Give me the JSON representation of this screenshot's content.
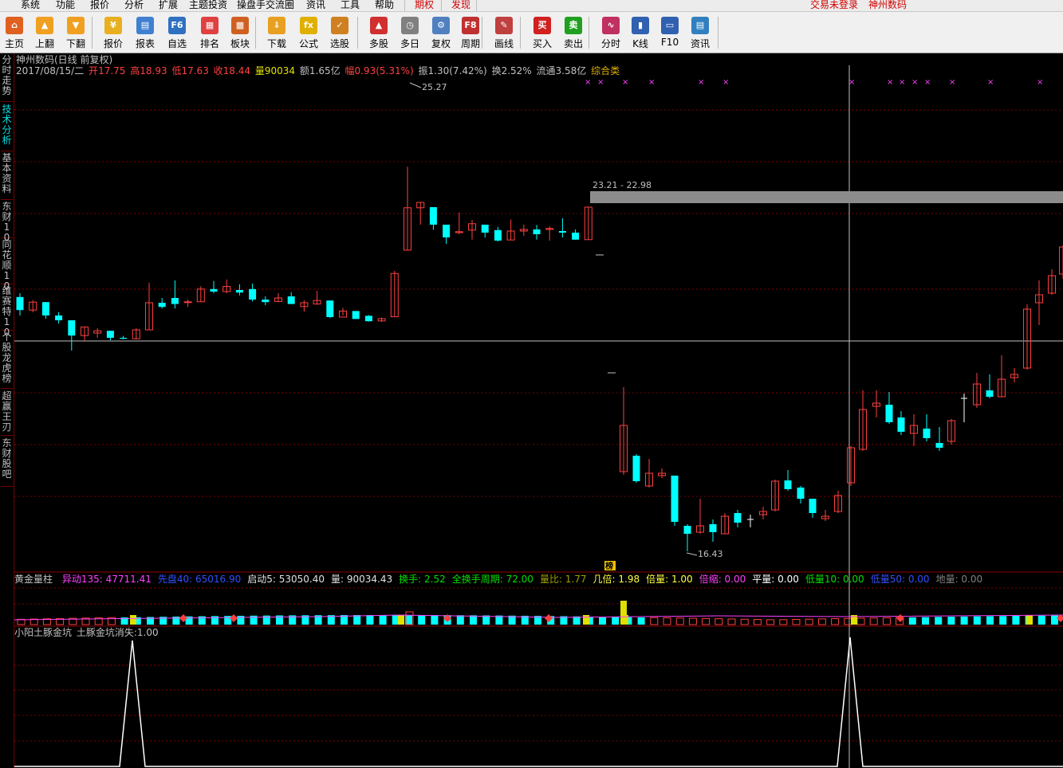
{
  "menu": {
    "items": [
      "系统",
      "功能",
      "报价",
      "分析",
      "扩展",
      "主题投资",
      "操盘手交流圈",
      "资讯",
      "工具",
      "帮助"
    ],
    "special": [
      "期权",
      "发现"
    ],
    "login_status": "交易未登录",
    "account_name": "神州数码"
  },
  "toolbar": {
    "buttons": [
      {
        "label": "主页",
        "icon": "home-icon",
        "color": "#e06020",
        "glyph": "⌂"
      },
      {
        "label": "上翻",
        "icon": "arrow-up-icon",
        "color": "#f0a020",
        "glyph": "▲"
      },
      {
        "label": "下翻",
        "icon": "arrow-down-icon",
        "color": "#f0a020",
        "glyph": "▼"
      },
      {
        "label": "报价",
        "icon": "yen-icon",
        "color": "#e8b020",
        "glyph": "¥"
      },
      {
        "label": "报表",
        "icon": "report-icon",
        "color": "#4080d0",
        "glyph": "▤"
      },
      {
        "label": "自选",
        "icon": "f6-icon",
        "color": "#3070c0",
        "glyph": "F6"
      },
      {
        "label": "排名",
        "icon": "rank-icon",
        "color": "#e04040",
        "glyph": "▦"
      },
      {
        "label": "板块",
        "icon": "sector-icon",
        "color": "#d06020",
        "glyph": "▩"
      },
      {
        "label": "下载",
        "icon": "download-icon",
        "color": "#e8a020",
        "glyph": "⇓"
      },
      {
        "label": "公式",
        "icon": "formula-icon",
        "color": "#e0b000",
        "glyph": "fx"
      },
      {
        "label": "选股",
        "icon": "stock-pick-icon",
        "color": "#d08020",
        "glyph": "✓"
      },
      {
        "label": "多股",
        "icon": "multi-stock-icon",
        "color": "#d03030",
        "glyph": "▲"
      },
      {
        "label": "多日",
        "icon": "multi-day-icon",
        "color": "#808080",
        "glyph": "◷"
      },
      {
        "label": "复权",
        "icon": "restore-right-icon",
        "color": "#5080c0",
        "glyph": "⚙"
      },
      {
        "label": "周期",
        "icon": "period-f8-icon",
        "color": "#c03030",
        "glyph": "F8"
      },
      {
        "label": "画线",
        "icon": "draw-line-icon",
        "color": "#c04040",
        "glyph": "✎"
      },
      {
        "label": "买入",
        "icon": "buy-icon",
        "color": "#d02020",
        "glyph": "买"
      },
      {
        "label": "卖出",
        "icon": "sell-icon",
        "color": "#20a020",
        "glyph": "卖"
      },
      {
        "label": "分时",
        "icon": "intraday-icon",
        "color": "#c03060",
        "glyph": "∿"
      },
      {
        "label": "K线",
        "icon": "kline-icon",
        "color": "#3060b0",
        "glyph": "▮"
      },
      {
        "label": "F10",
        "icon": "f10-icon",
        "color": "#3060b0",
        "glyph": "▭"
      },
      {
        "label": "资讯",
        "icon": "news-icon",
        "color": "#3080c0",
        "glyph": "▤"
      }
    ]
  },
  "sidebar": {
    "tabs": [
      {
        "label": "分时走势",
        "active": false
      },
      {
        "label": "技术分析",
        "active": true
      },
      {
        "label": "基本资料",
        "active": false
      },
      {
        "label": "东财10",
        "active": false
      },
      {
        "label": "同花顺10",
        "active": false
      },
      {
        "label": "维赛特10",
        "active": false
      },
      {
        "label": "个股龙虎榜",
        "active": false
      },
      {
        "label": "超赢王刃",
        "active": false
      },
      {
        "label": "东财股吧",
        "active": false
      }
    ]
  },
  "stock": {
    "title": "神州数码(日线 前复权)",
    "date": "2017/08/15/二",
    "open_label": "开",
    "open": "17.75",
    "high_label": "高",
    "high": "18.93",
    "low_label": "低",
    "low": "17.63",
    "close_label": "收",
    "close": "18.44",
    "volume_label": "量",
    "volume": "90034",
    "amount_label": "额",
    "amount": "1.65亿",
    "change_label": "幅",
    "change": "0.93(5.31%)",
    "amplitude_label": "振",
    "amplitude": "1.30(7.42%)",
    "turnover_label": "换",
    "turnover": "2.52%",
    "float_label": "流通",
    "float": "3.58亿",
    "category": "综合类"
  },
  "chart_labels": {
    "peak": "25.27",
    "trough": "16.43",
    "range": "23.21 - 22.98",
    "rank_badge": "榜"
  },
  "indicator1": {
    "name": "黄金量柱",
    "fields": [
      {
        "label": "异动135:",
        "value": "47711.41",
        "color": "#ff40ff"
      },
      {
        "label": "先盘40:",
        "value": "65016.90",
        "color": "#3050ff"
      },
      {
        "label": "启动5:",
        "value": "53050.40",
        "color": "#e0e0e0"
      },
      {
        "label": "量:",
        "value": "90034.43",
        "color": "#e0e0e0"
      },
      {
        "label": "换手:",
        "value": "2.52",
        "color": "#00e000"
      },
      {
        "label": "全换手周期:",
        "value": "72.00",
        "color": "#00e000"
      },
      {
        "label": "量比:",
        "value": "1.77",
        "color": "#a0a000"
      },
      {
        "label": "几倍:",
        "value": "1.98",
        "color": "#ffff40"
      },
      {
        "label": "倍量:",
        "value": "1.00",
        "color": "#ffff40"
      },
      {
        "label": "倍缩:",
        "value": "0.00",
        "color": "#ff40ff"
      },
      {
        "label": "平量:",
        "value": "0.00",
        "color": "#ffffff"
      },
      {
        "label": "低量10:",
        "value": "0.00",
        "color": "#00e000"
      },
      {
        "label": "低量50:",
        "value": "0.00",
        "color": "#3050ff"
      },
      {
        "label": "地量:",
        "value": "0.00",
        "color": "#808080"
      }
    ]
  },
  "indicator2": {
    "name": "小阳土豚金坑",
    "field_label": "土豚金坑消失:",
    "field_value": "1.00"
  },
  "colors": {
    "up": "#ff4040",
    "down": "#00ffff",
    "grid": "#8b0000",
    "text": "#c0c0c0"
  },
  "chart_data": {
    "type": "candlestick",
    "title": "神州数码(日线 前复权)",
    "price_range": [
      16.0,
      26.0
    ],
    "peak": 25.27,
    "trough": 16.43,
    "candles": [
      [
        21.18,
        20.77,
        21.3,
        20.6
      ],
      [
        20.77,
        21.02,
        21.08,
        20.7
      ],
      [
        21.02,
        20.6,
        21.02,
        20.5
      ],
      [
        20.6,
        20.45,
        20.7,
        20.35
      ],
      [
        20.45,
        19.97,
        20.45,
        19.5
      ],
      [
        19.97,
        20.24,
        20.24,
        19.8
      ],
      [
        20.05,
        20.12,
        20.2,
        19.9
      ],
      [
        20.12,
        19.9,
        20.12,
        19.82
      ],
      [
        19.9,
        19.87,
        19.96,
        19.85
      ],
      [
        19.87,
        20.15,
        20.2,
        19.85
      ],
      [
        20.15,
        21.0,
        21.63,
        20.15
      ],
      [
        21.0,
        20.87,
        21.15,
        20.82
      ],
      [
        21.15,
        20.96,
        21.7,
        20.82
      ],
      [
        21.01,
        21.03,
        21.1,
        20.87
      ],
      [
        21.03,
        21.43,
        21.52,
        21.03
      ],
      [
        21.43,
        21.35,
        21.68,
        21.3
      ],
      [
        21.35,
        21.51,
        21.73,
        21.3
      ],
      [
        21.4,
        21.32,
        21.58,
        21.23
      ],
      [
        21.43,
        21.1,
        21.6,
        21.04
      ],
      [
        21.1,
        21.02,
        21.2,
        20.92
      ],
      [
        21.04,
        21.15,
        21.3,
        21.02
      ],
      [
        21.2,
        20.96,
        21.33,
        20.96
      ],
      [
        20.88,
        21.0,
        21.08,
        20.72
      ],
      [
        20.96,
        21.07,
        21.37,
        20.94
      ],
      [
        21.07,
        20.55,
        21.07,
        20.52
      ],
      [
        20.55,
        20.74,
        20.84,
        20.6
      ],
      [
        20.74,
        20.49,
        20.74,
        20.49
      ],
      [
        20.59,
        20.42,
        20.61,
        20.41
      ],
      [
        20.43,
        20.5,
        20.54,
        20.4
      ],
      [
        20.56,
        21.92,
        22.0,
        20.56
      ],
      [
        22.65,
        23.98,
        25.27,
        22.65
      ],
      [
        23.98,
        24.15,
        24.15,
        23.45
      ],
      [
        24.0,
        23.45,
        24.0,
        23.29
      ],
      [
        23.45,
        23.05,
        23.45,
        22.85
      ],
      [
        23.2,
        23.23,
        23.83,
        23.15
      ],
      [
        23.28,
        23.48,
        23.6,
        22.98
      ],
      [
        23.45,
        23.2,
        23.45,
        23.05
      ],
      [
        23.28,
        22.95,
        23.38,
        22.92
      ],
      [
        22.97,
        23.25,
        23.61,
        22.97
      ],
      [
        23.25,
        23.3,
        23.45,
        23.1
      ],
      [
        23.3,
        23.15,
        23.44,
        22.98
      ],
      [
        23.3,
        23.33,
        23.4,
        22.95
      ],
      [
        23.25,
        23.2,
        23.65,
        23.05
      ],
      [
        23.2,
        22.98,
        23.3,
        22.98
      ],
      [
        22.98,
        24.0,
        24.0,
        22.98
      ]
    ]
  }
}
